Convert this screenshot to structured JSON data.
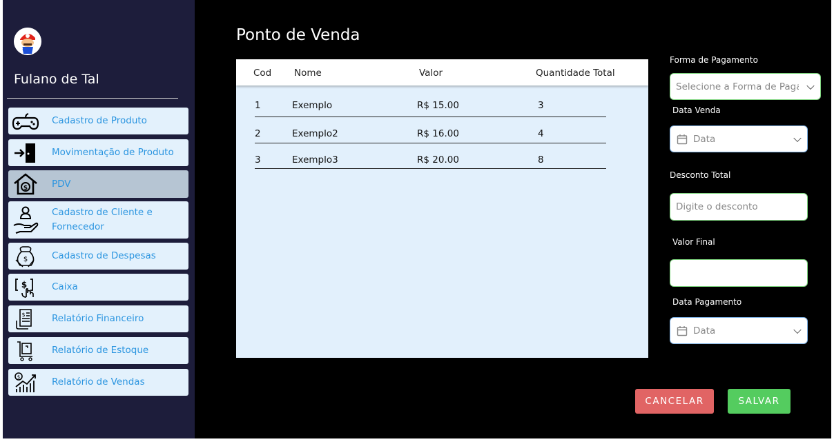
{
  "user": {
    "name": "Fulano de Tal"
  },
  "sidebar": {
    "items": [
      {
        "label": "Cadastro de Produto",
        "icon": "gamepad-icon"
      },
      {
        "label": "Movimentação de Produto",
        "icon": "door-enter-icon"
      },
      {
        "label": "PDV",
        "icon": "house-money-icon",
        "active": true
      },
      {
        "label": "Cadastro de Cliente e Fornecedor",
        "icon": "hand-person-icon"
      },
      {
        "label": "Cadastro de Despesas",
        "icon": "money-bag-hand-icon"
      },
      {
        "label": "Caixa",
        "icon": "cash-register-icon"
      },
      {
        "label": "Relatório Financeiro",
        "icon": "financial-report-icon"
      },
      {
        "label": "Relatório de Estoque",
        "icon": "stock-cart-icon"
      },
      {
        "label": "Relatório de Vendas",
        "icon": "sales-chart-icon"
      }
    ]
  },
  "main": {
    "title": "Ponto de Venda",
    "table": {
      "headers": {
        "cod": "Cod",
        "nome": "Nome",
        "valor": "Valor",
        "quantidade": "Quantidade Total"
      },
      "rows": [
        {
          "cod": "1",
          "nome": "Exemplo",
          "valor": "R$ 15.00",
          "quantidade": "3"
        },
        {
          "cod": "2",
          "nome": "Exemplo2",
          "valor": "R$ 16.00",
          "quantidade": "4"
        },
        {
          "cod": "3",
          "nome": "Exemplo3",
          "valor": "R$ 20.00",
          "quantidade": "8"
        }
      ]
    }
  },
  "form": {
    "payment": {
      "label": "Forma de Pagamento",
      "placeholder": "Selecione a Forma de Paga"
    },
    "sale_date": {
      "label": "Data Venda",
      "placeholder": "Data"
    },
    "discount": {
      "label": "Desconto Total",
      "placeholder": "Digite o desconto"
    },
    "final_value": {
      "label": "Valor Final",
      "value": ""
    },
    "payment_date": {
      "label": "Data Pagamento",
      "placeholder": "Data"
    }
  },
  "actions": {
    "cancel": "CANCELAR",
    "save": "SALVAR"
  },
  "colors": {
    "sidebar_bg": "#1d1d3b",
    "nav_item_bg": "#e3f1fc",
    "nav_item_active_bg": "#b6c5d3",
    "nav_text": "#2b95e0",
    "table_bg": "#e2f0fc",
    "cancel": "#e16464",
    "save": "#54cc5f"
  }
}
